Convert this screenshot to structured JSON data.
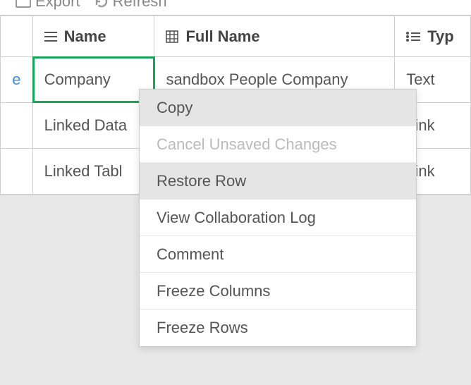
{
  "toolbar": {
    "export_label": "Export",
    "refresh_label": "Refresh"
  },
  "table": {
    "headers": {
      "col1": "Name",
      "col2": "Full Name",
      "col3": "Typ"
    },
    "rows": [
      {
        "link": "e",
        "name": "Company",
        "fullname": "sandbox People Company",
        "type": "Text"
      },
      {
        "link": "",
        "name": "Linked Data",
        "fullname": "",
        "type": "Link"
      },
      {
        "link": "",
        "name": "Linked Tabl",
        "fullname": "",
        "type": "Link"
      }
    ]
  },
  "context_menu": {
    "items": [
      {
        "label": "Copy",
        "state": "highlighted"
      },
      {
        "label": "Cancel Unsaved Changes",
        "state": "disabled"
      },
      {
        "label": "Restore Row",
        "state": "highlighted"
      },
      {
        "label": "View Collaboration Log",
        "state": "normal"
      },
      {
        "label": "Comment",
        "state": "normal"
      },
      {
        "label": "Freeze Columns",
        "state": "normal"
      },
      {
        "label": "Freeze Rows",
        "state": "normal"
      }
    ]
  }
}
